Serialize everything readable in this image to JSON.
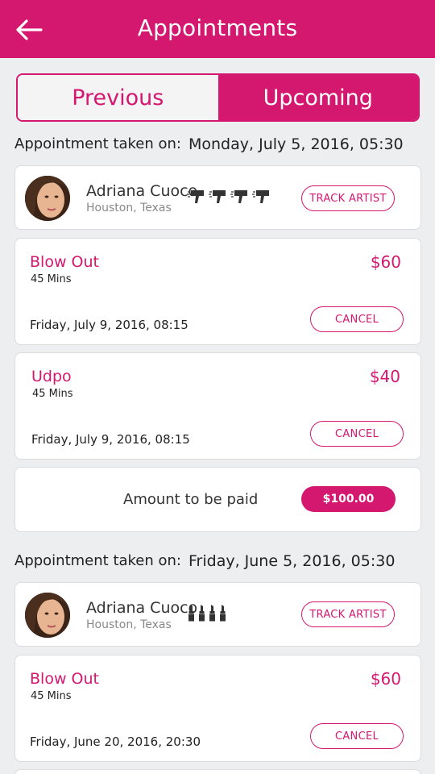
{
  "header": {
    "title": "Appointments",
    "back_icon": "arrow-left-icon"
  },
  "tabs": {
    "previous": "Previous",
    "upcoming": "Upcoming",
    "active": "Upcoming"
  },
  "colors": {
    "brand": "#d4176f",
    "background": "#eceef0",
    "card": "#ffffff"
  },
  "appointments": [
    {
      "taken_label": "Appointment taken on:",
      "taken_date": "Monday, July 5, 2016, 05:30",
      "artist": {
        "name": "Adriana Cuoco",
        "location": "Houston, Texas",
        "tools_icon": "hair-dryer-icon",
        "tools_count": 4,
        "track_label": "TRACK ARTIST"
      },
      "services": [
        {
          "name": "Blow Out",
          "duration": "45 Mins",
          "price": "$60",
          "date": "Friday, July 9, 2016, 08:15",
          "cancel_label": "CANCEL"
        },
        {
          "name": "Udpo",
          "duration": "45 Mins",
          "price": "$40",
          "date": "Friday, July 9, 2016, 08:15",
          "cancel_label": "CANCEL"
        }
      ],
      "amount": {
        "label": "Amount to be paid",
        "value": "$100.00"
      }
    },
    {
      "taken_label": "Appointment taken on:",
      "taken_date": "Friday, June 5, 2016, 05:30",
      "artist": {
        "name": "Adriana Cuoco",
        "location": "Houston, Texas",
        "tools_icon": "lipstick-icon",
        "tools_count": 4,
        "track_label": "TRACK ARTIST"
      },
      "services": [
        {
          "name": "Blow Out",
          "duration": "45 Mins",
          "price": "$60",
          "date": "Friday, June 20, 2016, 20:30",
          "cancel_label": "CANCEL"
        }
      ]
    }
  ]
}
